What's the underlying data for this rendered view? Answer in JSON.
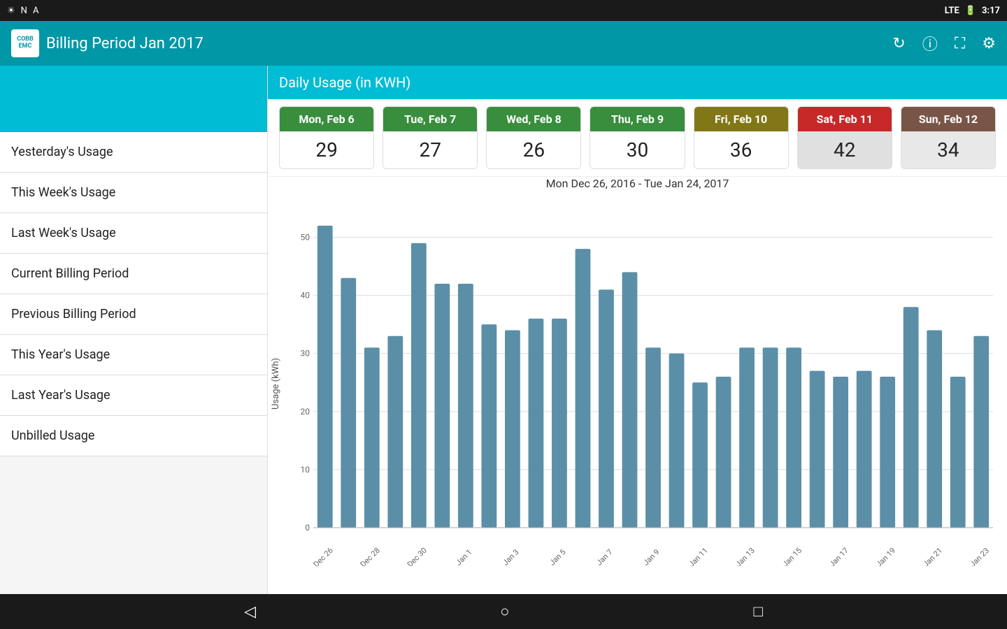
{
  "statusBar": {
    "leftIcons": [
      "☀",
      "N",
      "A"
    ],
    "rightText": "3:17"
  },
  "header": {
    "logoLine1": "COBB",
    "logoLine2": "EMC",
    "title": "Billing Period Jan 2017",
    "icons": [
      "↻",
      "ⓘ",
      "⛶",
      "⚙"
    ]
  },
  "sidebar": {
    "items": [
      {
        "label": "Yesterday's Usage"
      },
      {
        "label": "This Week's Usage"
      },
      {
        "label": "Last Week's Usage"
      },
      {
        "label": "Current Billing Period"
      },
      {
        "label": "Previous Billing Period"
      },
      {
        "label": "This Year's Usage"
      },
      {
        "label": "Last Year's Usage"
      },
      {
        "label": "Unbilled Usage"
      }
    ]
  },
  "dailyUsage": {
    "sectionTitle": "Daily Usage (in KWH)",
    "days": [
      {
        "label": "Mon, Feb 6",
        "value": "29",
        "color": "#388e3c",
        "type": "weekday"
      },
      {
        "label": "Tue, Feb 7",
        "value": "27",
        "color": "#388e3c",
        "type": "weekday"
      },
      {
        "label": "Wed, Feb 8",
        "value": "26",
        "color": "#388e3c",
        "type": "weekday"
      },
      {
        "label": "Thu, Feb 9",
        "value": "30",
        "color": "#388e3c",
        "type": "weekday"
      },
      {
        "label": "Fri, Feb 10",
        "value": "36",
        "color": "#827717",
        "type": "weekday"
      },
      {
        "label": "Sat, Feb 11",
        "value": "42",
        "color": "#c62828",
        "type": "sat"
      },
      {
        "label": "Sun, Feb 12",
        "value": "34",
        "color": "#795548",
        "type": "sun"
      }
    ]
  },
  "chart": {
    "subtitle": "Mon Dec 26, 2016 - Tue Jan 24, 2017",
    "yAxisLabel": "Usage (kWh)",
    "yMax": 50,
    "barColor": "#5b8fa8",
    "xLabels": [
      "Dec 26",
      "Dec 28",
      "Dec 30",
      "Jan 1",
      "Jan 3",
      "Jan 5",
      "Jan 7",
      "Jan 9",
      "Jan 11",
      "Jan 13",
      "Jan 15",
      "Jan 17",
      "Jan 19",
      "Jan 21",
      "Jan 23"
    ],
    "bars": [
      52,
      43,
      31,
      33,
      49,
      42,
      42,
      35,
      34,
      36,
      36,
      48,
      41,
      44,
      31,
      30,
      25,
      26,
      31,
      31,
      31,
      27,
      26,
      27,
      26,
      38,
      34,
      26,
      33
    ]
  },
  "bottomNav": {
    "back": "◁",
    "home": "○",
    "recent": "□"
  }
}
